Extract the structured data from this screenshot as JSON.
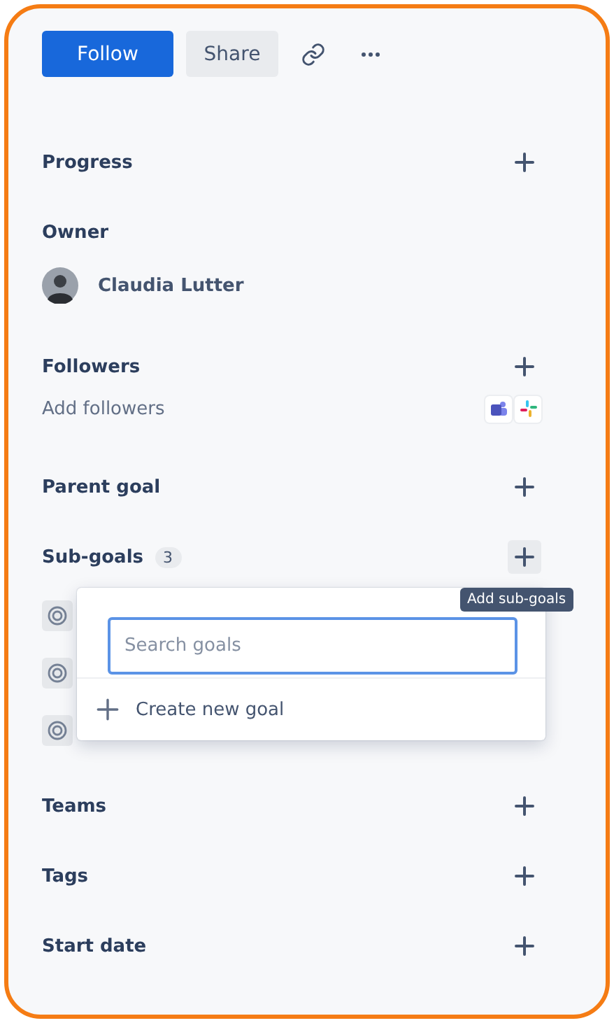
{
  "toolbar": {
    "follow_button": "Follow",
    "share_button": "Share"
  },
  "sections": [
    {
      "kind": "plain",
      "title": "Progress"
    },
    {
      "kind": "owner",
      "title": "Owner",
      "owner_name": "Claudia Lutter"
    },
    {
      "kind": "followers",
      "title": "Followers",
      "hint": "Add followers"
    },
    {
      "kind": "plain",
      "title": "Parent goal"
    },
    {
      "kind": "subgoals",
      "title": "Sub-goals",
      "count": "3",
      "rows": [
        {
          "kind": "goal"
        },
        {
          "kind": "goal"
        },
        {
          "kind": "goal"
        }
      ],
      "tooltip": "Add sub-goals",
      "popover": {
        "search_placeholder": "Search goals",
        "create_label": "Create new goal"
      }
    },
    {
      "kind": "plain",
      "title": "Teams"
    },
    {
      "kind": "plain",
      "title": "Tags"
    },
    {
      "kind": "plain",
      "title": "Start date"
    }
  ]
}
